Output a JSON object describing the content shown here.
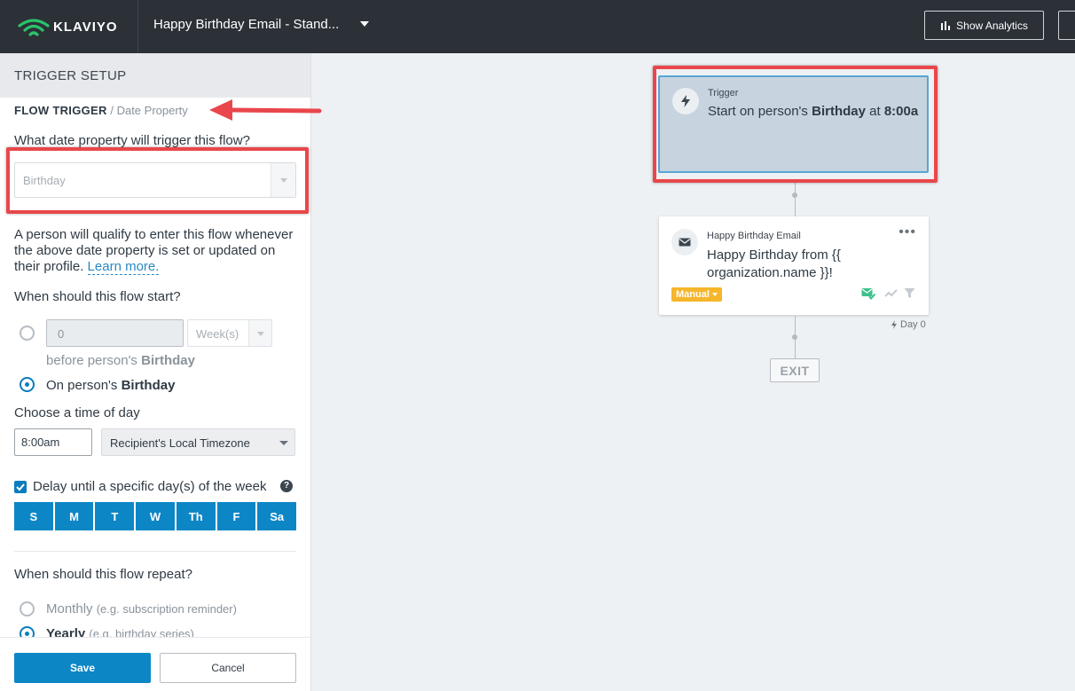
{
  "app": {
    "brand_name": "KLAVIYO",
    "flow_title": "Happy Birthday Email - Stand...",
    "analytics_button": "Show Analytics"
  },
  "panel": {
    "header_title": "TRIGGER SETUP",
    "breadcrumb_main": "FLOW TRIGGER",
    "breadcrumb_separator": "/",
    "breadcrumb_sub": "Date Property",
    "date_question": "What date property will trigger this flow?",
    "date_property_value": "Birthday",
    "info_text": "A person will qualify to enter this flow whenever the above date property is set or updated on their profile.",
    "learn_more": "Learn more.",
    "start_question": "When should this flow start?",
    "offset_value": "0",
    "offset_unit": "Week(s)",
    "before_text": "before person's",
    "before_bold": "Birthday",
    "on_text": "On person's",
    "on_bold": "Birthday",
    "time_question": "Choose a time of day",
    "time_value": "8:00am",
    "timezone_value": "Recipient's Local Timezone",
    "delay_label": "Delay until a specific day(s) of the week",
    "help_icon": "?",
    "days": [
      "S",
      "M",
      "T",
      "W",
      "Th",
      "F",
      "Sa"
    ],
    "repeat_question": "When should this flow repeat?",
    "monthly_label": "Monthly",
    "monthly_hint": "(e.g. subscription reminder)",
    "yearly_label": "Yearly",
    "yearly_hint": "(e.g. birthday series)",
    "save_button": "Save",
    "cancel_button": "Cancel"
  },
  "canvas": {
    "trigger_label": "Trigger",
    "trigger_text_start": "Start on person's",
    "trigger_text_bold1": "Birthday",
    "trigger_text_mid": "at",
    "trigger_text_bold2": "8:00a",
    "email_label": "Happy Birthday Email",
    "email_subject": "Happy Birthday from {{ organization.name }}!",
    "email_more": "•••",
    "email_badge": "Manual",
    "day_label": "Day 0",
    "exit_label": "EXIT"
  },
  "colors": {
    "topbar": "#2c3138",
    "primary": "#0d86c6",
    "annotation": "#e9474b",
    "badge": "#f5b62b",
    "success": "#3cc18a"
  }
}
